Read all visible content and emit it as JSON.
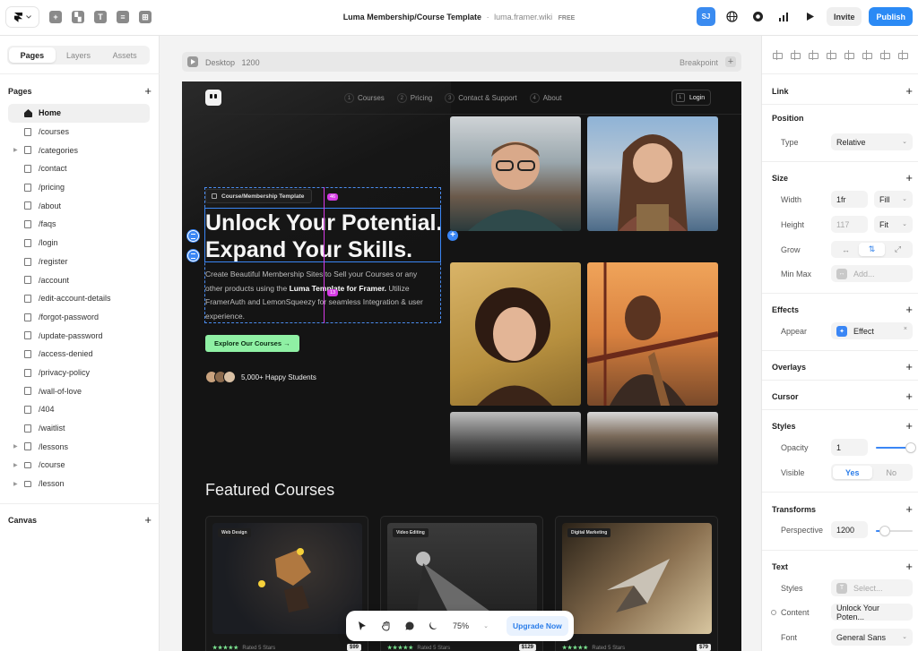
{
  "app": {
    "doc_title": "Luma Membership/Course Template",
    "domain": "luma.framer.wiki",
    "plan_badge": "FREE",
    "user_initials": "SJ",
    "invite_label": "Invite",
    "publish_label": "Publish",
    "accent_color": "#2b8af5"
  },
  "left_panel": {
    "tabs": [
      "Pages",
      "Layers",
      "Assets"
    ],
    "active_tab": "Pages",
    "pages_heading": "Pages",
    "canvas_heading": "Canvas",
    "pages": [
      {
        "label": "Home",
        "icon": "home-icon",
        "active": true
      },
      {
        "label": "/courses",
        "icon": "page-icon"
      },
      {
        "label": "/categories",
        "icon": "page-icon",
        "expandable": true
      },
      {
        "label": "/contact",
        "icon": "page-icon"
      },
      {
        "label": "/pricing",
        "icon": "page-icon"
      },
      {
        "label": "/about",
        "icon": "page-icon"
      },
      {
        "label": "/faqs",
        "icon": "page-icon"
      },
      {
        "label": "/login",
        "icon": "page-icon"
      },
      {
        "label": "/register",
        "icon": "page-icon"
      },
      {
        "label": "/account",
        "icon": "page-icon"
      },
      {
        "label": "/edit-account-details",
        "icon": "page-icon"
      },
      {
        "label": "/forgot-password",
        "icon": "page-icon"
      },
      {
        "label": "/update-password",
        "icon": "page-icon"
      },
      {
        "label": "/access-denied",
        "icon": "page-icon"
      },
      {
        "label": "/privacy-policy",
        "icon": "page-icon"
      },
      {
        "label": "/wall-of-love",
        "icon": "page-icon"
      },
      {
        "label": "/404",
        "icon": "page-icon"
      },
      {
        "label": "/waitlist",
        "icon": "page-icon"
      },
      {
        "label": "/lessons",
        "icon": "page-icon",
        "expandable": true
      },
      {
        "label": "/course",
        "icon": "folder-icon",
        "expandable": true
      },
      {
        "label": "/lesson",
        "icon": "folder-icon",
        "expandable": true
      }
    ]
  },
  "canvas": {
    "breakpoint_name": "Desktop",
    "breakpoint_width": "1200",
    "breakpoint_label": "Breakpoint",
    "zoom": "75%",
    "upgrade_label": "Upgrade Now"
  },
  "site": {
    "nav": [
      {
        "num": "1",
        "label": "Courses"
      },
      {
        "num": "2",
        "label": "Pricing"
      },
      {
        "num": "3",
        "label": "Contact & Support"
      },
      {
        "num": "4",
        "label": "About"
      }
    ],
    "login_key": "L",
    "login_label": "Login",
    "tag": "Course/Membership Template",
    "gap_badge": "46",
    "gap_badge_2": "13",
    "hero_line1": "Unlock Your Potential.",
    "hero_line2": "Expand Your Skills.",
    "desc_a": "Create Beautiful Membership Sites to Sell your Courses or any other products using the ",
    "desc_bold": "Luma Template for Framer.",
    "desc_b": " Utilize FramerAuth and LemonSqueezy for seamless Integration & user experience.",
    "cta": "Explore Our Courses →",
    "students": "5,000+ Happy Students",
    "featured_title": "Featured Courses",
    "courses": [
      {
        "tag": "Web Design",
        "stars": "★★★★★",
        "rating": "Rated 5 Stars",
        "price": "$99"
      },
      {
        "tag": "Video Editing",
        "stars": "★★★★★",
        "rating": "Rated 5 Stars",
        "price": "$129"
      },
      {
        "tag": "Digital Marketing",
        "stars": "★★★★★",
        "rating": "Rated 5 Stars",
        "price": "$79"
      }
    ]
  },
  "right_panel": {
    "link": "Link",
    "position": "Position",
    "type_label": "Type",
    "type_value": "Relative",
    "size": "Size",
    "width_label": "Width",
    "width_value": "1fr",
    "width_mode": "Fill",
    "height_label": "Height",
    "height_value": "117",
    "height_mode": "Fit",
    "grow_label": "Grow",
    "minmax_label": "Min Max",
    "minmax_value": "Add...",
    "effects": "Effects",
    "appear_label": "Appear",
    "appear_value": "Effect",
    "overlays": "Overlays",
    "cursor": "Cursor",
    "styles": "Styles",
    "opacity_label": "Opacity",
    "opacity_value": "1",
    "visible_label": "Visible",
    "visible_yes": "Yes",
    "visible_no": "No",
    "transforms": "Transforms",
    "perspective_label": "Perspective",
    "perspective_value": "1200",
    "text": "Text",
    "text_styles_label": "Styles",
    "text_styles_value": "Select...",
    "content_label": "Content",
    "content_value": "Unlock Your Poten...",
    "font_label": "Font",
    "font_value": "General Sans"
  }
}
